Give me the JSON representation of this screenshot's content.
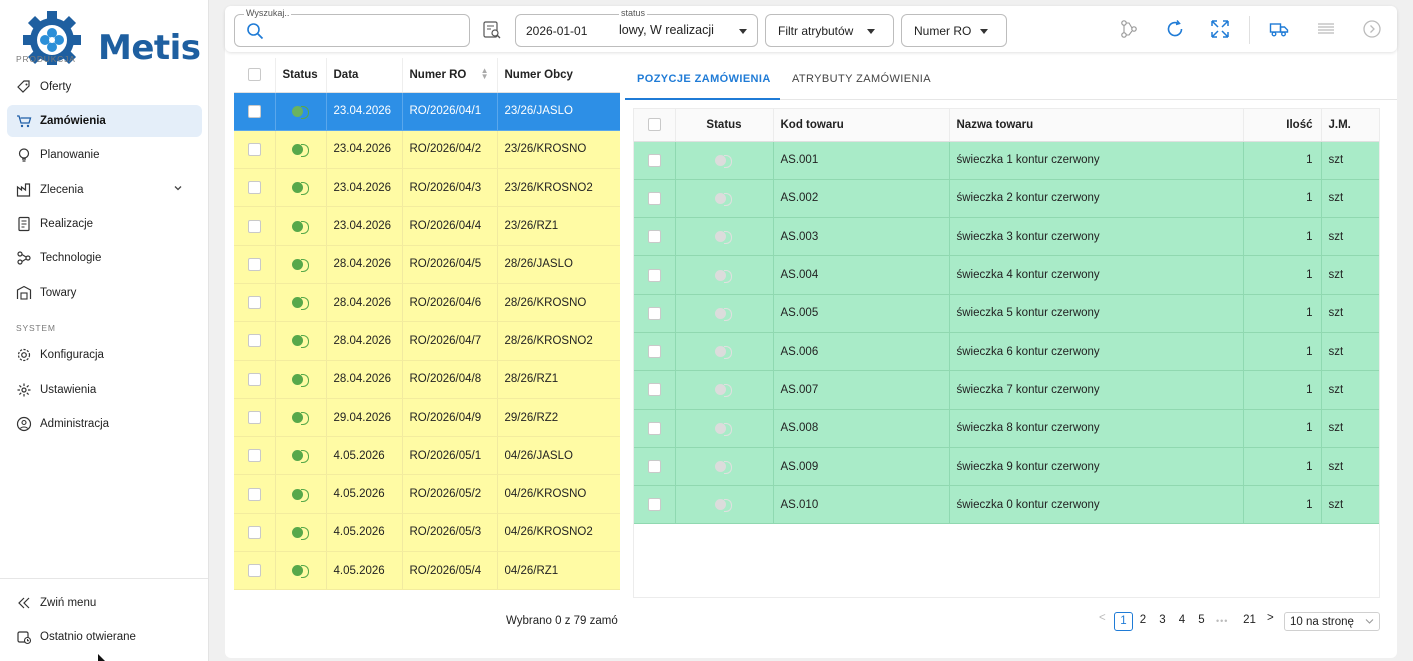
{
  "app": {
    "name": "Metis"
  },
  "sidebar": {
    "section_production": "PRODUKCJA",
    "section_system": "SYSTEM",
    "items": [
      {
        "label": "Oferty",
        "icon": "tag-icon"
      },
      {
        "label": "Zamówienia",
        "icon": "cart-icon",
        "active": true
      },
      {
        "label": "Planowanie",
        "icon": "lightbulb-icon"
      },
      {
        "label": "Zlecenia",
        "icon": "factory-icon",
        "expandable": true
      },
      {
        "label": "Realizacje",
        "icon": "document-icon"
      },
      {
        "label": "Technologie",
        "icon": "network-icon"
      },
      {
        "label": "Towary",
        "icon": "warehouse-icon"
      }
    ],
    "system_items": [
      {
        "label": "Konfiguracja",
        "icon": "gear-icon"
      },
      {
        "label": "Ustawienia",
        "icon": "cog-icon"
      },
      {
        "label": "Administracja",
        "icon": "user-shield-icon"
      }
    ],
    "collapse_label": "Zwiń menu",
    "recent_label": "Ostatnio otwierane"
  },
  "toolbar": {
    "search": {
      "label": "Wyszukaj..",
      "value": ""
    },
    "status": {
      "label": "status",
      "date": "2026-01-01",
      "value": "lowy, W realizacji"
    },
    "attr_filter": "Filtr atrybutów",
    "ro_filter": "Numer RO"
  },
  "orders": {
    "columns": [
      "Status",
      "Data",
      "Numer RO",
      "Numer Obcy"
    ],
    "rows": [
      {
        "date": "23.04.2026",
        "ro": "RO/2026/04/1",
        "ext": "23/26/JASLO",
        "selected": true
      },
      {
        "date": "23.04.2026",
        "ro": "RO/2026/04/2",
        "ext": "23/26/KROSNO"
      },
      {
        "date": "23.04.2026",
        "ro": "RO/2026/04/3",
        "ext": "23/26/KROSNO2"
      },
      {
        "date": "23.04.2026",
        "ro": "RO/2026/04/4",
        "ext": "23/26/RZ1"
      },
      {
        "date": "28.04.2026",
        "ro": "RO/2026/04/5",
        "ext": "28/26/JASLO"
      },
      {
        "date": "28.04.2026",
        "ro": "RO/2026/04/6",
        "ext": "28/26/KROSNO"
      },
      {
        "date": "28.04.2026",
        "ro": "RO/2026/04/7",
        "ext": "28/26/KROSNO2"
      },
      {
        "date": "28.04.2026",
        "ro": "RO/2026/04/8",
        "ext": "28/26/RZ1"
      },
      {
        "date": "29.04.2026",
        "ro": "RO/2026/04/9",
        "ext": "29/26/RZ2"
      },
      {
        "date": "4.05.2026",
        "ro": "RO/2026/05/1",
        "ext": "04/26/JASLO"
      },
      {
        "date": "4.05.2026",
        "ro": "RO/2026/05/2",
        "ext": "04/26/KROSNO"
      },
      {
        "date": "4.05.2026",
        "ro": "RO/2026/05/3",
        "ext": "04/26/KROSNO2"
      },
      {
        "date": "4.05.2026",
        "ro": "RO/2026/05/4",
        "ext": "04/26/RZ1"
      }
    ],
    "footer": "Wybrano 0 z 79 zamó"
  },
  "detail": {
    "tabs": [
      "POZYCJE ZAMÓWIENIA",
      "ATRYBUTY ZAMÓWIENIA"
    ],
    "columns": [
      "Status",
      "Kod towaru",
      "Nazwa towaru",
      "Ilość",
      "J.M."
    ],
    "rows": [
      {
        "code": "AS.001",
        "name": "świeczka 1 kontur czerwony",
        "qty": "1",
        "unit": "szt"
      },
      {
        "code": "AS.002",
        "name": "świeczka 2 kontur czerwony",
        "qty": "1",
        "unit": "szt"
      },
      {
        "code": "AS.003",
        "name": "świeczka 3 kontur czerwony",
        "qty": "1",
        "unit": "szt"
      },
      {
        "code": "AS.004",
        "name": "świeczka 4 kontur czerwony",
        "qty": "1",
        "unit": "szt"
      },
      {
        "code": "AS.005",
        "name": "świeczka 5 kontur czerwony",
        "qty": "1",
        "unit": "szt"
      },
      {
        "code": "AS.006",
        "name": "świeczka 6 kontur czerwony",
        "qty": "1",
        "unit": "szt"
      },
      {
        "code": "AS.007",
        "name": "świeczka 7 kontur czerwony",
        "qty": "1",
        "unit": "szt"
      },
      {
        "code": "AS.008",
        "name": "świeczka 8 kontur czerwony",
        "qty": "1",
        "unit": "szt"
      },
      {
        "code": "AS.009",
        "name": "świeczka 9 kontur czerwony",
        "qty": "1",
        "unit": "szt"
      },
      {
        "code": "AS.010",
        "name": "świeczka 0 kontur czerwony",
        "qty": "1",
        "unit": "szt"
      }
    ]
  },
  "pagination": {
    "pages": [
      "1",
      "2",
      "3",
      "4",
      "5"
    ],
    "current": "1",
    "ellipsis": "•••",
    "last": "21",
    "page_size": "10 na stronę"
  },
  "colors": {
    "accent": "#1f7bd6",
    "selected_row": "#2d8fe6",
    "order_row": "#fffba4",
    "item_row": "#a9ebc8",
    "status_green": "#57a84a"
  }
}
